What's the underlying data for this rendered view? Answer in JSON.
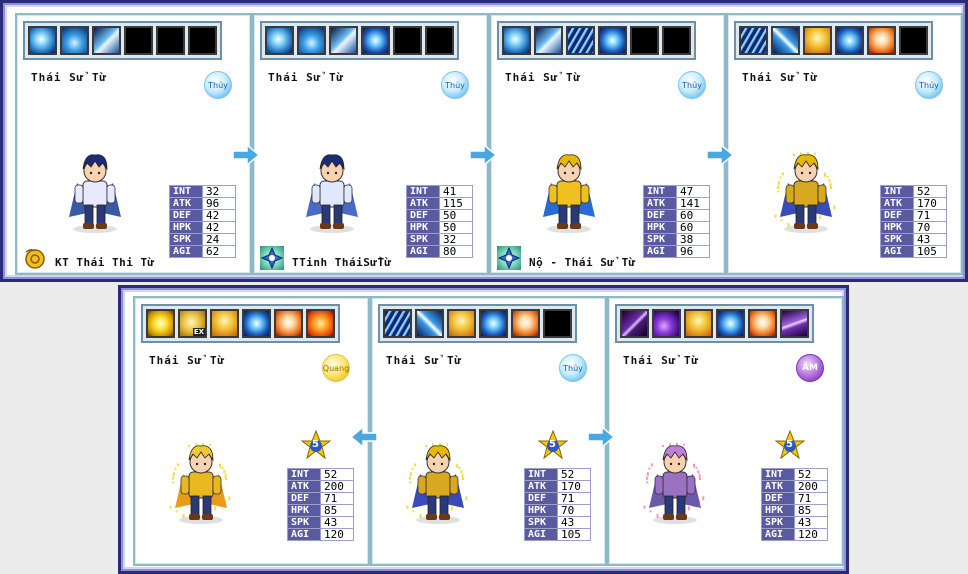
{
  "top_row": [
    {
      "skills": [
        "ice-burst-skill-icon",
        "ice-wave-skill-icon",
        "ice-shard-skill-icon",
        "empty",
        "empty",
        "empty"
      ],
      "name": "Thái Sử Từ",
      "element": "Thủy",
      "stats": [
        [
          "INT",
          "32"
        ],
        [
          "ATK",
          "96"
        ],
        [
          "DEF",
          "42"
        ],
        [
          "HPK",
          "42"
        ],
        [
          "SPK",
          "24"
        ],
        [
          "AGI",
          "62"
        ]
      ],
      "caption": "KT Thái Thi Từ",
      "caption_icon": "gold-coin-icon",
      "palette": {
        "hair": "#1c2a78",
        "body": "#e8e8ff",
        "cape": "#3a5aa8"
      }
    },
    {
      "skills": [
        "ice-burst-skill-icon",
        "ice-wave-skill-icon",
        "ice-shard-skill-icon",
        "whirlpool-skill-icon",
        "empty",
        "empty"
      ],
      "name": "Thái Sử Từ",
      "element": "Thủy",
      "stats": [
        [
          "INT",
          "41"
        ],
        [
          "ATK",
          "115"
        ],
        [
          "DEF",
          "50"
        ],
        [
          "HPK",
          "50"
        ],
        [
          "SPK",
          "32"
        ],
        [
          "AGI",
          "80"
        ]
      ],
      "caption": "TTinh TháiSửTừ",
      "caption_icon": "crystal-gem-icon",
      "palette": {
        "hair": "#1c2a78",
        "body": "#dfe8ff",
        "cape": "#4a6ac8"
      }
    },
    {
      "skills": [
        "ice-burst-skill-icon",
        "ice-shard-skill-icon",
        "ice-claw-skill-icon",
        "whirlpool-skill-icon",
        "empty",
        "empty"
      ],
      "name": "Thái Sử Từ",
      "element": "Thủy",
      "stats": [
        [
          "INT",
          "47"
        ],
        [
          "ATK",
          "141"
        ],
        [
          "DEF",
          "60"
        ],
        [
          "HPK",
          "60"
        ],
        [
          "SPK",
          "38"
        ],
        [
          "AGI",
          "96"
        ]
      ],
      "caption": "Nộ - Thái Sử Từ",
      "caption_icon": "crystal-gem-icon",
      "palette": {
        "hair": "#e8b800",
        "body": "#f0c020",
        "cape": "#2a6ad8"
      }
    },
    {
      "skills": [
        "ice-claw-skill-icon",
        "ice-slash-skill-icon",
        "golden-warrior-skill-icon",
        "whirlpool-skill-icon",
        "fire-spirit-skill-icon",
        "empty"
      ],
      "name": "Thái Sử Từ",
      "element": "Thủy",
      "stats": [
        [
          "INT",
          "52"
        ],
        [
          "ATK",
          "170"
        ],
        [
          "DEF",
          "71"
        ],
        [
          "HPK",
          "70"
        ],
        [
          "SPK",
          "43"
        ],
        [
          "AGI",
          "105"
        ]
      ],
      "caption": "",
      "caption_icon": "",
      "palette": {
        "hair": "#e8b800",
        "body": "#d8a820",
        "cape": "#3a4ab8"
      }
    }
  ],
  "bottom_row": [
    {
      "skills": [
        "lightning-skill-icon",
        "golden-palm-ex-skill-icon",
        "golden-warrior-skill-icon",
        "whirlpool-skill-icon",
        "fire-spirit-skill-icon",
        "flame-strike-skill-icon"
      ],
      "ex_label": "EX",
      "name": "Thái Sử Từ",
      "element": "Quang",
      "star_level": "5",
      "stats": [
        [
          "INT",
          "52"
        ],
        [
          "ATK",
          "200"
        ],
        [
          "DEF",
          "71"
        ],
        [
          "HPK",
          "85"
        ],
        [
          "SPK",
          "43"
        ],
        [
          "AGI",
          "120"
        ]
      ],
      "palette": {
        "hair": "#f0c830",
        "body": "#e8b820",
        "cape": "#e89a18"
      }
    },
    {
      "skills": [
        "ice-claw-skill-icon",
        "ice-slash-skill-icon",
        "golden-warrior-skill-icon",
        "whirlpool-skill-icon",
        "fire-spirit-skill-icon",
        "empty"
      ],
      "name": "Thái Sử Từ",
      "element": "Thủy",
      "star_level": "5",
      "stats": [
        [
          "INT",
          "52"
        ],
        [
          "ATK",
          "170"
        ],
        [
          "DEF",
          "71"
        ],
        [
          "HPK",
          "70"
        ],
        [
          "SPK",
          "43"
        ],
        [
          "AGI",
          "105"
        ]
      ],
      "palette": {
        "hair": "#e8b800",
        "body": "#d8a820",
        "cape": "#3a4ab8"
      }
    },
    {
      "skills": [
        "dark-blade-skill-icon",
        "shadow-wave-skill-icon",
        "golden-warrior-skill-icon",
        "whirlpool-skill-icon",
        "fire-spirit-skill-icon",
        "dark-vortex-skill-icon"
      ],
      "name": "Thái Sử Từ",
      "element": "ÂM",
      "star_level": "5",
      "stats": [
        [
          "INT",
          "52"
        ],
        [
          "ATK",
          "200"
        ],
        [
          "DEF",
          "71"
        ],
        [
          "HPK",
          "85"
        ],
        [
          "SPK",
          "43"
        ],
        [
          "AGI",
          "120"
        ]
      ],
      "palette": {
        "hair": "#c080d8",
        "body": "#9a70c0",
        "cape": "#6a5aa8"
      }
    }
  ],
  "colors": {
    "frame_border": "#2a2a78",
    "card_border": "#8fb8c8",
    "stat_label_bg": "#5a5aa0",
    "arrow": "#4aa8e0"
  }
}
